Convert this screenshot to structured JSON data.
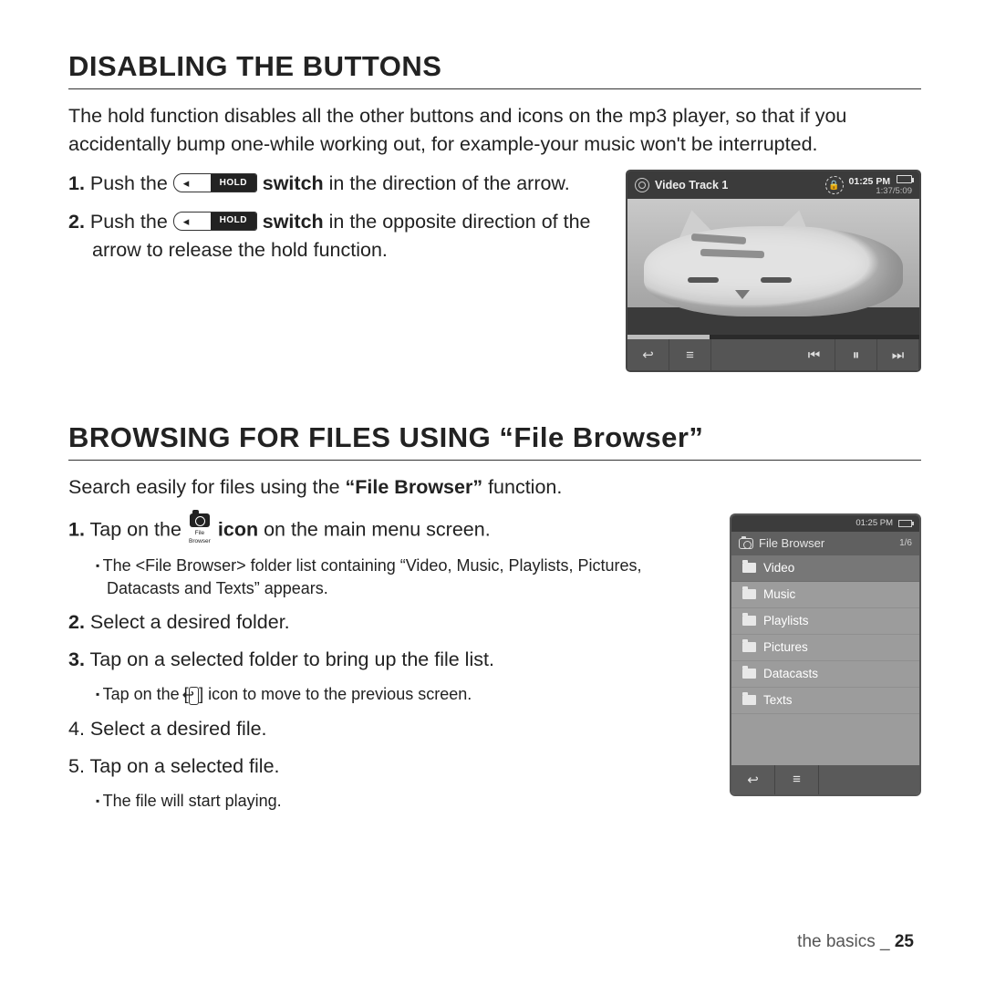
{
  "section1": {
    "heading": "DISABLING THE BUTTONS",
    "lead": "The hold function disables all the other buttons and icons on the mp3 player, so that if you accidentally bump one-while working out, for example-your music won't be interrupted.",
    "step1_a": "Push the ",
    "step1_b": " in the direction of the arrow.",
    "switch_word": "switch",
    "step2_a": "Push the ",
    "step2_b": " in the opposite direction of the arrow to release the hold function.",
    "hold_label": "HOLD"
  },
  "player": {
    "title": "Video Track 1",
    "clock": "01:25 PM",
    "elapsed": "1:37/5:09"
  },
  "section2": {
    "heading": "BROWSING FOR FILES USING “File Browser”",
    "lead_a": "Search easily for files using the ",
    "lead_b": "“File Browser”",
    "lead_c": " function.",
    "step1_a": "Tap on the ",
    "step1_b": " on the main menu screen.",
    "icon_word": "icon",
    "icon_caption": "File Browser",
    "sub1": "The <File Browser> folder list containing “Video, Music, Playlists, Pictures, Datacasts and Texts” appears.",
    "step2": "Select a desired folder.",
    "step3": "Tap on a selected folder to bring up the file list.",
    "sub3_a": "Tap on the [",
    "sub3_b": "] icon to move to the previous screen.",
    "return_glyph": "↩",
    "step4": "Select a desired file.",
    "step5": "Tap on a selected file.",
    "sub5": "The file will start playing."
  },
  "browser": {
    "clock": "01:25 PM",
    "title": "File Browser",
    "count": "1/6",
    "items": [
      "Video",
      "Music",
      "Playlists",
      "Pictures",
      "Datacasts",
      "Texts"
    ],
    "selected_index": 0
  },
  "footer": {
    "label": "the basics _",
    "page": "25"
  }
}
